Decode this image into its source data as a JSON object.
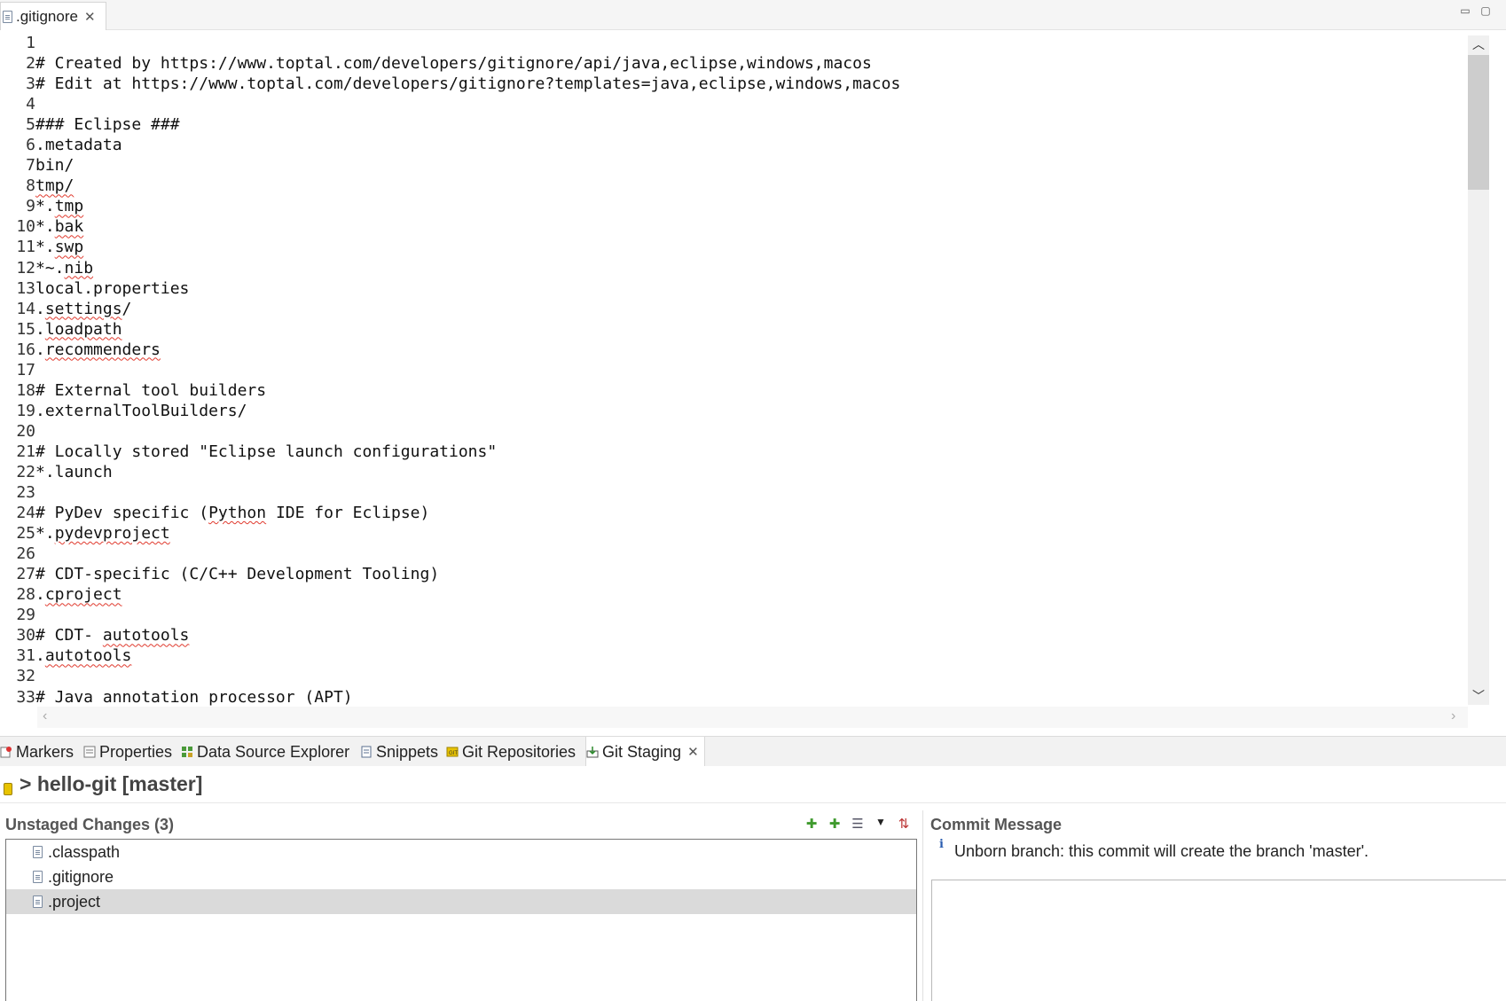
{
  "editor": {
    "tab_label": ".gitignore",
    "tab_close": "✕",
    "minimize": "▭",
    "maximize": "▢",
    "lines": [
      [],
      [
        {
          "t": "# Created by https://www.toptal.com/developers/gitignore/api/java,eclipse,windows,macos"
        }
      ],
      [
        {
          "t": "# Edit at https://www.toptal.com/developers/gitignore?templates=java,eclipse,windows,macos"
        }
      ],
      [],
      [
        {
          "t": "### Eclipse ###"
        }
      ],
      [
        {
          "t": ".metadata"
        }
      ],
      [
        {
          "t": "bin/"
        }
      ],
      [
        {
          "t": "tmp/",
          "s": true
        }
      ],
      [
        {
          "t": "*."
        },
        {
          "t": "tmp",
          "s": true
        }
      ],
      [
        {
          "t": "*."
        },
        {
          "t": "bak",
          "s": true
        }
      ],
      [
        {
          "t": "*."
        },
        {
          "t": "swp",
          "s": true
        }
      ],
      [
        {
          "t": "*~."
        },
        {
          "t": "nib",
          "s": true
        }
      ],
      [
        {
          "t": "local.properties"
        }
      ],
      [
        {
          "t": "."
        },
        {
          "t": "settings",
          "s": true
        },
        {
          "t": "/"
        }
      ],
      [
        {
          "t": "."
        },
        {
          "t": "loadpath",
          "s": true
        }
      ],
      [
        {
          "t": "."
        },
        {
          "t": "recommenders",
          "s": true
        }
      ],
      [],
      [
        {
          "t": "# External tool builders"
        }
      ],
      [
        {
          "t": ".externalToolBuilders/"
        }
      ],
      [],
      [
        {
          "t": "# Locally stored \"Eclipse launch configurations\""
        }
      ],
      [
        {
          "t": "*.launch"
        }
      ],
      [],
      [
        {
          "t": "# PyDev specific ("
        },
        {
          "t": "Python",
          "s": true
        },
        {
          "t": " IDE for Eclipse)"
        }
      ],
      [
        {
          "t": "*."
        },
        {
          "t": "pydevproject",
          "s": true
        }
      ],
      [],
      [
        {
          "t": "# CDT-specific (C/C++ Development Tooling)"
        }
      ],
      [
        {
          "t": "."
        },
        {
          "t": "cproject",
          "s": true
        }
      ],
      [],
      [
        {
          "t": "# CDT- "
        },
        {
          "t": "autotools",
          "s": true
        }
      ],
      [
        {
          "t": "."
        },
        {
          "t": "autotools",
          "s": true
        }
      ],
      [],
      [
        {
          "t": "# Java annotation processor (APT)"
        }
      ]
    ]
  },
  "views": {
    "tabs": [
      {
        "name": "tab-markers",
        "label": "Markers",
        "icon": "markers-icon"
      },
      {
        "name": "tab-properties",
        "label": "Properties",
        "icon": "properties-icon"
      },
      {
        "name": "tab-data-source-explorer",
        "label": "Data Source Explorer",
        "icon": "data-source-icon"
      },
      {
        "name": "tab-snippets",
        "label": "Snippets",
        "icon": "snippets-icon"
      },
      {
        "name": "tab-git-repositories",
        "label": "Git Repositories",
        "icon": "git-repositories-icon"
      },
      {
        "name": "tab-git-staging",
        "label": "Git Staging",
        "icon": "git-staging-icon",
        "active": true
      }
    ],
    "close": "✕"
  },
  "staging": {
    "repo_title": "> hello-git [master]",
    "unstaged_title": "Unstaged Changes (3)",
    "files": [
      {
        "label": ".classpath",
        "icon": "classpath-file-icon"
      },
      {
        "label": ".gitignore",
        "icon": "text-file-icon"
      },
      {
        "label": ".project",
        "icon": "project-file-icon",
        "selected": true
      }
    ],
    "tools": {
      "add": "✚",
      "add_all": "✚",
      "tree": "☰",
      "menu": "▼",
      "sort": "⇅"
    },
    "commit_title": "Commit Message",
    "commit_info_icon": "i",
    "commit_info": "Unborn branch: this commit will create the branch 'master'."
  },
  "colors": {
    "spell_underline": "#e03a2e",
    "add_icon": "#3f9a2e",
    "menu_icon": "#222222"
  }
}
